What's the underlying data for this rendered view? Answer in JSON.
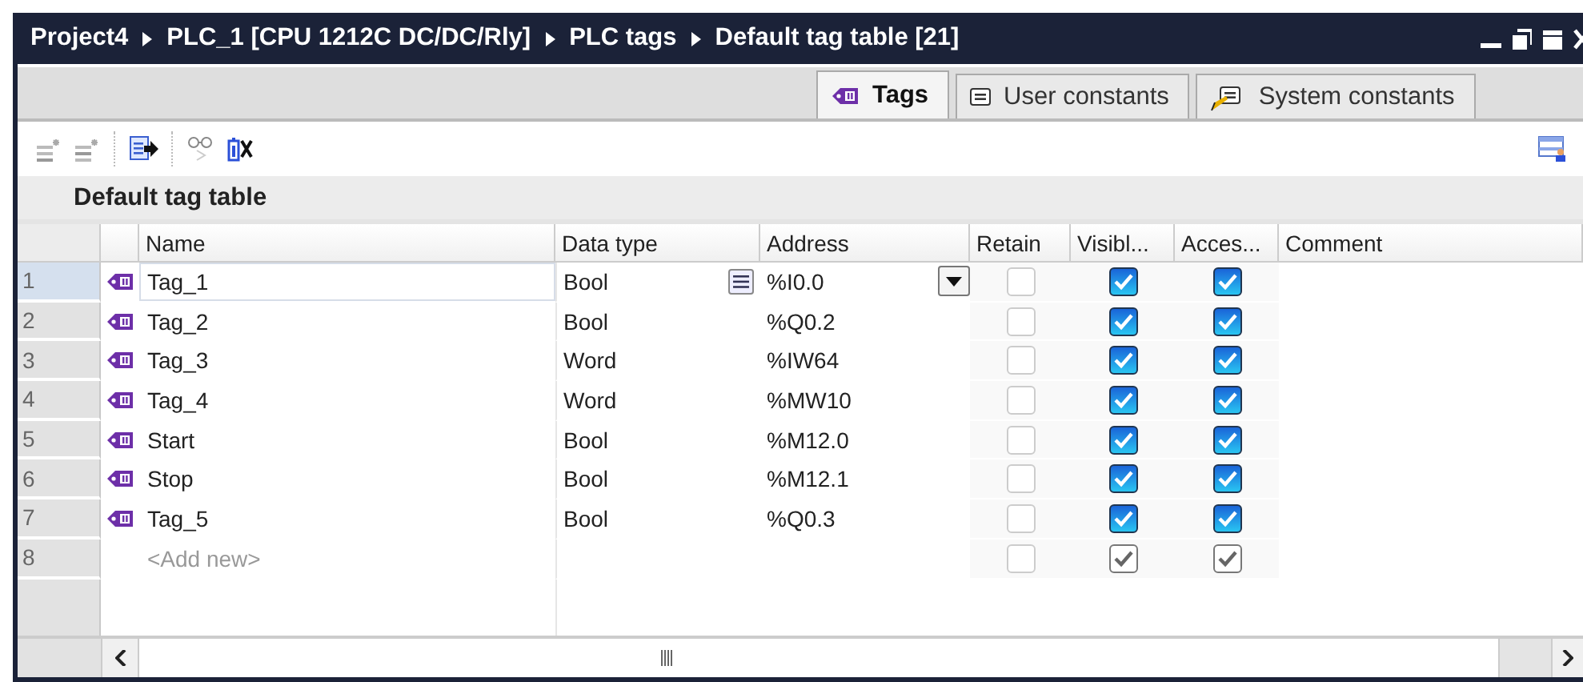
{
  "title_bar": {
    "breadcrumbs": [
      "Project4",
      "PLC_1 [CPU 1212C DC/DC/Rly]",
      "PLC tags",
      "Default tag table [21]"
    ]
  },
  "tabs": [
    {
      "label": "Tags",
      "selected": true,
      "kind": "tags"
    },
    {
      "label": "User constants",
      "selected": false,
      "kind": "user"
    },
    {
      "label": "System constants",
      "selected": false,
      "kind": "system"
    }
  ],
  "section_title": "Default tag table",
  "table": {
    "columns": [
      "Name",
      "Data type",
      "Address",
      "Retain",
      "Visibl...",
      "Acces...",
      "Comment"
    ],
    "rows": [
      {
        "number": "1",
        "kind": "tag",
        "name": "Tag_1",
        "data_type": "Bool",
        "address": "%I0.0",
        "retain": false,
        "visible": true,
        "accessible": true,
        "selected": true
      },
      {
        "number": "2",
        "kind": "tag",
        "name": "Tag_2",
        "data_type": "Bool",
        "address": "%Q0.2",
        "retain": false,
        "visible": true,
        "accessible": true,
        "selected": false
      },
      {
        "number": "3",
        "kind": "tag",
        "name": "Tag_3",
        "data_type": "Word",
        "address": "%IW64",
        "retain": false,
        "visible": true,
        "accessible": true,
        "selected": false
      },
      {
        "number": "4",
        "kind": "tag",
        "name": "Tag_4",
        "data_type": "Word",
        "address": "%MW10",
        "retain": false,
        "visible": true,
        "accessible": true,
        "selected": false
      },
      {
        "number": "5",
        "kind": "tag",
        "name": "Start",
        "data_type": "Bool",
        "address": "%M12.0",
        "retain": false,
        "visible": true,
        "accessible": true,
        "selected": false
      },
      {
        "number": "6",
        "kind": "tag",
        "name": "Stop",
        "data_type": "Bool",
        "address": "%M12.1",
        "retain": false,
        "visible": true,
        "accessible": true,
        "selected": false
      },
      {
        "number": "7",
        "kind": "tag",
        "name": "Tag_5",
        "data_type": "Bool",
        "address": "%Q0.3",
        "retain": false,
        "visible": true,
        "accessible": true,
        "selected": false
      },
      {
        "number": "8",
        "kind": "new",
        "name": "<Add new>",
        "retain": false,
        "visible": true,
        "accessible": true,
        "selected": false
      }
    ]
  }
}
